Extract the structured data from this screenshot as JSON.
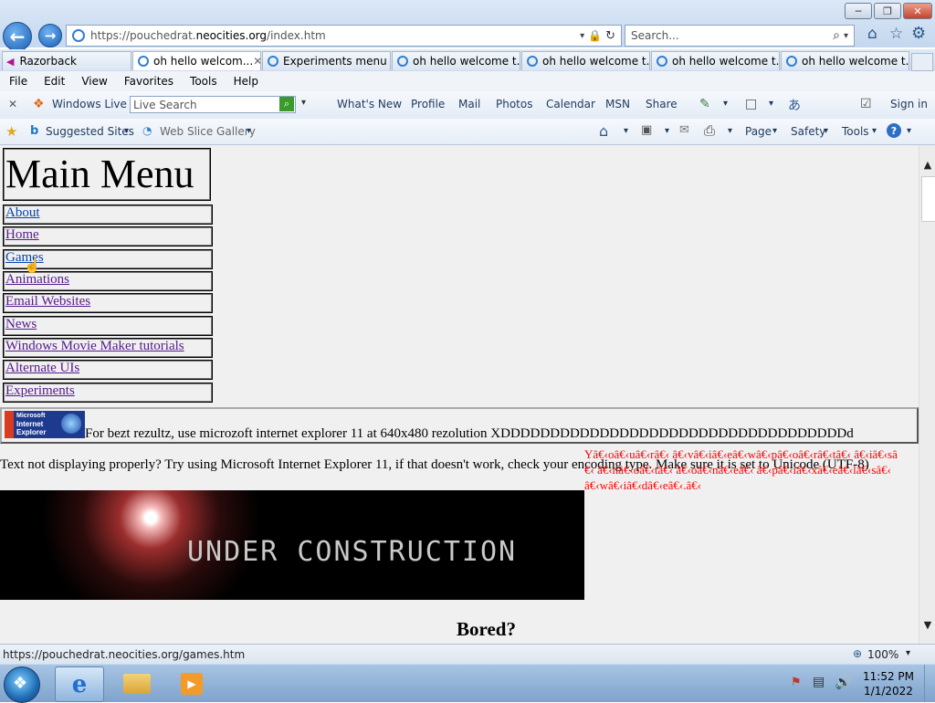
{
  "window": {
    "minimize_glyph": "─",
    "restore_glyph": "❐",
    "close_glyph": "✕"
  },
  "address_bar": {
    "url_prefix": "https://pouchedrat.",
    "url_domain": "neocities.org",
    "url_path": "/index.htm"
  },
  "search_bar": {
    "placeholder": "Search..."
  },
  "tabs": [
    {
      "label": "Razorback"
    },
    {
      "label": "oh hello welcom...",
      "active": true
    },
    {
      "label": "Experiments menu"
    },
    {
      "label": "oh hello welcome t..."
    },
    {
      "label": "oh hello welcome t..."
    },
    {
      "label": "oh hello welcome t..."
    },
    {
      "label": "oh hello welcome t..."
    }
  ],
  "menu_bar": [
    "File",
    "Edit",
    "View",
    "Favorites",
    "Tools",
    "Help"
  ],
  "live_toolbar": {
    "brand": "Windows Live",
    "search_placeholder": "Live Search",
    "links": [
      "What's New",
      "Profile",
      "Mail",
      "Photos",
      "Calendar",
      "MSN",
      "Share"
    ],
    "sign_in": "Sign in"
  },
  "favorites_bar": {
    "suggested": "Suggested Sites",
    "web_slice": "Web Slice Gallery",
    "page": "Page",
    "safety": "Safety",
    "tools": "Tools"
  },
  "page": {
    "menu_title": "Main Menu",
    "menu_items": [
      "About",
      "Home",
      "Games",
      "Animations",
      "Email Websites",
      "News",
      "Windows Movie Maker tutorials",
      "Alternate UIs",
      "Experiments"
    ],
    "ie_badge_lines": [
      "Microsoft",
      "Internet",
      "Explorer"
    ],
    "ie_notice": "For bezt rezultz, use microzoft internet explorer 11 at 640x480 rezolution XDDDDDDDDDDDDDDDDDDDDDDDDDDDDDDDDDDDd",
    "encoding_notice": "Text not displaying properly? Try using Microsoft Internet Explorer 11, if that doesn't work, check your encoding type. Make sure it is set to Unicode (UTF-8)",
    "garbled_text": "Yâ€‹oâ€‹uâ€‹râ€‹ â€‹vâ€‹iâ€‹eâ€‹wâ€‹pâ€‹oâ€‹râ€‹tâ€‹ â€‹iâ€‹sâ€‹ â€‹nâ€‹oâ€‹tâ€‹ â€‹oâ€‹nâ€‹eâ€‹ â€‹pâ€‹iâ€‹xâ€‹eâ€‹lâ€‹sâ€‹ â€‹wâ€‹iâ€‹dâ€‹eâ€‹.â€‹",
    "banner_text": "UNDER CONSTRUCTION",
    "bored_heading": "Bored?"
  },
  "status_bar": {
    "url": "https://pouchedrat.neocities.org/games.htm",
    "zoom": "100%"
  },
  "taskbar": {
    "time": "11:52 PM",
    "date": "1/1/2022"
  },
  "colors": {
    "link_visited": "#551a8b",
    "link_unvisited": "#0645ad",
    "garbled_red": "#ff0000",
    "page_bg": "#f0f0f0"
  }
}
